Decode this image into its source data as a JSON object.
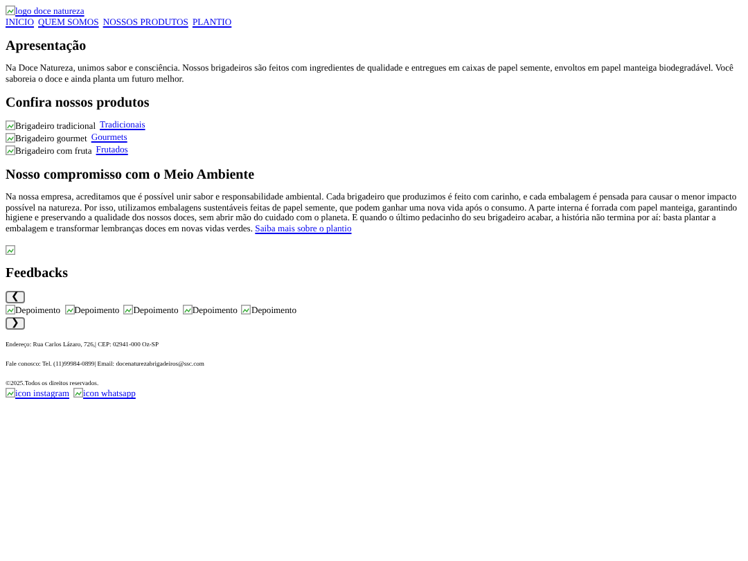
{
  "header": {
    "logo_alt": "logo doce natureza",
    "nav": [
      "INICIO",
      "QUEM SOMOS",
      "NOSSOS PRODUTOS",
      "PLANTIO"
    ]
  },
  "intro": {
    "title": "Apresentação",
    "text": "Na Doce Natureza, unimos sabor e consciência. Nossos brigadeiros são feitos com ingredientes de qualidade e entregues em caixas de papel semente, envoltos em papel manteiga biodegradável. Você saboreia o doce e ainda planta um futuro melhor."
  },
  "products": {
    "title": "Confira nossos produtos",
    "items": [
      {
        "alt": "Brigadeiro tradicional",
        "link": "Tradicionais"
      },
      {
        "alt": "Brigadeiro gourmet",
        "link": "Gourmets"
      },
      {
        "alt": "Brigadeiro com fruta",
        "link": "Frutados"
      }
    ]
  },
  "environment": {
    "title": "Nosso compromisso com o Meio Ambiente",
    "text": "Na nossa empresa, acreditamos que é possível unir sabor e responsabilidade ambiental. Cada brigadeiro que produzimos é feito com carinho, e cada embalagem é pensada para causar o menor impacto possível na natureza. Por isso, utilizamos embalagens sustentáveis feitas de papel semente, que podem ganhar uma nova vida após o consumo. A parte interna é forrada com papel manteiga, garantindo higiene e preservando a qualidade dos nossos doces, sem abrir mão do cuidado com o planeta. E quando o último pedacinho do seu brigadeiro acabar, a história não termina por aí: basta plantar a embalagem e transformar lembranças doces em novas vidas verdes.",
    "link": "Saiba mais sobre o plantio"
  },
  "feedbacks": {
    "title": "Feedbacks",
    "prev": "❮",
    "next": "❯",
    "items": [
      "Depoimento",
      "Depoimento",
      "Depoimento",
      "Depoimento",
      "Depoimento"
    ]
  },
  "footer": {
    "address": "Endereço: Rua Carlos Lázaro, 726,| CEP: 02941-000 Oz-SP",
    "contact": "Fale conosco: Tel. (11)99984-0899| Email: docenaturezabrigadeiros@ssc.com",
    "copyright": "©2025.Todos os direitos reservados.",
    "social": [
      "icon instagram",
      "icon whatsapp"
    ]
  }
}
